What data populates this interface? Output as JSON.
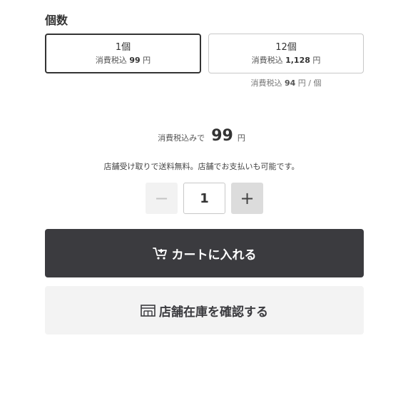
{
  "quantity_section": {
    "title": "個数",
    "options": [
      {
        "name": "1個",
        "price_label": "消費税込",
        "price": "99",
        "yen": "円",
        "selected": true
      },
      {
        "name": "12個",
        "price_label": "消費税込",
        "price": "1,128",
        "yen": "円",
        "selected": false
      }
    ],
    "unit_price": {
      "label": "消費税込",
      "price": "94",
      "suffix": "円 / 個"
    }
  },
  "total": {
    "label": "消費税込みで",
    "price": "99",
    "yen": "円"
  },
  "note": "店舗受け取りで送料無料。店舗でお支払いも可能です。",
  "stepper": {
    "minus": "−",
    "value": "1",
    "plus": "+"
  },
  "cart_button": {
    "label": "カートに入れる",
    "icon": "cart-icon"
  },
  "store_button": {
    "label": "店舗在庫を確認する",
    "icon": "store-icon"
  },
  "colors": {
    "dark": "#3b3b3f",
    "light_bg": "#f3f3f3",
    "border": "#c8c8c8"
  }
}
